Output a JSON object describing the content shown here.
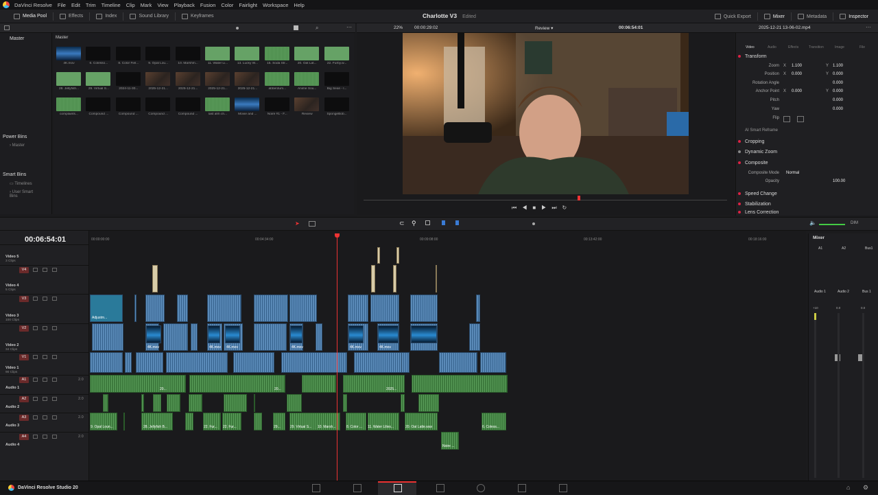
{
  "menu": [
    "DaVinci Resolve",
    "File",
    "Edit",
    "Trim",
    "Timeline",
    "Clip",
    "Mark",
    "View",
    "Playback",
    "Fusion",
    "Color",
    "Fairlight",
    "Workspace",
    "Help"
  ],
  "toolbar": {
    "media_pool": "Media Pool",
    "effects": "Effects",
    "index": "Index",
    "sound_library": "Sound Library",
    "keyframes": "Keyframes",
    "project_title": "Charlotte V3",
    "edited": "Edited",
    "quick_export": "Quick Export",
    "mixer": "Mixer",
    "metadata": "Metadata",
    "inspector": "Inspector"
  },
  "media_pool": {
    "master_left": "Master",
    "master_bin": "Master",
    "power_bins": "Power Bins",
    "power_master": "Master",
    "smart_bins": "Smart Bins",
    "timelines": "Timelines",
    "user_smart_bins": "User Smart Bins",
    "clips": [
      {
        "label": "4K.mov",
        "kind": "blue"
      },
      {
        "label": "6. Colesso...",
        "kind": "blk"
      },
      {
        "label": "8. Color Fiel...",
        "kind": "blk"
      },
      {
        "label": "9. Opal Lou...",
        "kind": "blk"
      },
      {
        "label": "10. Marshm...",
        "kind": "blk"
      },
      {
        "label": "11. Water Li...",
        "kind": "green"
      },
      {
        "label": "13. Lucky W...",
        "kind": "green"
      },
      {
        "label": "15. Soda Str...",
        "kind": "wave"
      },
      {
        "label": "20. Oat Lat...",
        "kind": "green"
      },
      {
        "label": "22. Furby.w...",
        "kind": "green"
      },
      {
        "label": "28. Jellyfish...",
        "kind": "green"
      },
      {
        "label": "29. Virtual S...",
        "kind": "green"
      },
      {
        "label": "2024-11-30...",
        "kind": "blk"
      },
      {
        "label": "2025-12-21...",
        "kind": "room"
      },
      {
        "label": "2025-12-21...",
        "kind": "room"
      },
      {
        "label": "2025-12-21...",
        "kind": "room"
      },
      {
        "label": "2025-12-21...",
        "kind": "room"
      },
      {
        "label": "abberdum...",
        "kind": "wave"
      },
      {
        "label": "Anime Sou...",
        "kind": "wave"
      },
      {
        "label": "Big Sean - l...",
        "kind": "blk"
      },
      {
        "label": "complaints...",
        "kind": "wave"
      },
      {
        "label": "Compound ...",
        "kind": "blk"
      },
      {
        "label": "Compound ...",
        "kind": "blk"
      },
      {
        "label": "Compound ...",
        "kind": "blk"
      },
      {
        "label": "Compound ...",
        "kind": "blk"
      },
      {
        "label": "last ahh ch...",
        "kind": "wave"
      },
      {
        "label": "Movie and ...",
        "kind": "blue"
      },
      {
        "label": "Noire #1 - F...",
        "kind": "blk"
      },
      {
        "label": "Review",
        "kind": "room"
      },
      {
        "label": "SpongeBob...",
        "kind": "blk"
      }
    ]
  },
  "viewer": {
    "zoom": "22%",
    "source_tc": "00:00:29:02",
    "timeline_name": "Review",
    "record_tc": "00:06:54:01"
  },
  "inspector": {
    "file": "2025-12-21 13-06-02.mp4",
    "tabs": [
      "Video",
      "Audio",
      "Effects",
      "Transition",
      "Image",
      "File"
    ],
    "transform": "Transform",
    "zoom_label": "Zoom",
    "zoom_x": "1.100",
    "zoom_y": "1.100",
    "position_label": "Position",
    "pos_x": "0.000",
    "pos_y": "0.000",
    "rotation_label": "Rotation Angle",
    "rotation": "0.000",
    "anchor_label": "Anchor Point",
    "anchor_x": "0.000",
    "anchor_y": "0.000",
    "pitch_label": "Pitch",
    "pitch": "0.000",
    "yaw_label": "Yaw",
    "yaw": "0.000",
    "flip_label": "Flip",
    "smart_reframe": "AI Smart Reframe",
    "cropping": "Cropping",
    "dynamic_zoom": "Dynamic Zoom",
    "composite": "Composite",
    "comp_mode_label": "Composite Mode",
    "comp_mode": "Normal",
    "opacity_label": "Opacity",
    "opacity": "100.00",
    "speed_change": "Speed Change",
    "stabilization": "Stabilization",
    "lens_correction": "Lens Correction"
  },
  "timeline": {
    "timecode": "00:06:54:01",
    "ruler": [
      "00:00:00:00",
      "00:04:34:00",
      "00:09:08:00",
      "00:13:42:00",
      "00:18:16:00"
    ],
    "dim": "DIM",
    "tracks": [
      {
        "badge": "V5",
        "name": "Video 5",
        "sub": "3 Clips"
      },
      {
        "badge": "V4",
        "name": "Video 4",
        "sub": "5 Clips"
      },
      {
        "badge": "V3",
        "name": "Video 3",
        "sub": "100 Clips"
      },
      {
        "badge": "V2",
        "name": "Video 2",
        "sub": "34 Clips"
      },
      {
        "badge": "V1",
        "name": "Video 1",
        "sub": "90 Clips"
      },
      {
        "badge": "A1",
        "name": "Audio 1",
        "vol": "2.0"
      },
      {
        "badge": "A2",
        "name": "Audio 2",
        "vol": "2.0"
      },
      {
        "badge": "A3",
        "name": "Audio 3",
        "vol": "2.0"
      },
      {
        "badge": "A4",
        "name": "Audio 4",
        "vol": "2.0"
      }
    ],
    "clip_labels": {
      "adjustment": "Adjustm...",
      "v2": [
        "4K.mov",
        "4K.mov",
        "4K.mov",
        "4K.mov",
        "4K.mov",
        "4K.mov"
      ],
      "a1": [
        "20...",
        "20...",
        "2025..."
      ],
      "a3": [
        "9. Opal Loun...",
        "28. Jellyfish B...",
        "22. Fur...",
        "22. Fur...",
        "29...",
        "29. Virtual S...",
        "10. Marsh...",
        "8. Color ...",
        "11. Water Lilies...",
        "20. Oat Latte.wav",
        "6. Coless..."
      ],
      "a4": [
        "Noire ..."
      ]
    }
  },
  "mixer": {
    "title": "Mixer",
    "channels": [
      "A1",
      "A2",
      "Bus1"
    ],
    "strip_names": [
      "Audio 1",
      "Audio 2",
      "Bus 1"
    ],
    "vals": [
      "+10",
      "0.0",
      "0.0"
    ]
  },
  "app_name": "DaVinci Resolve Studio 20"
}
